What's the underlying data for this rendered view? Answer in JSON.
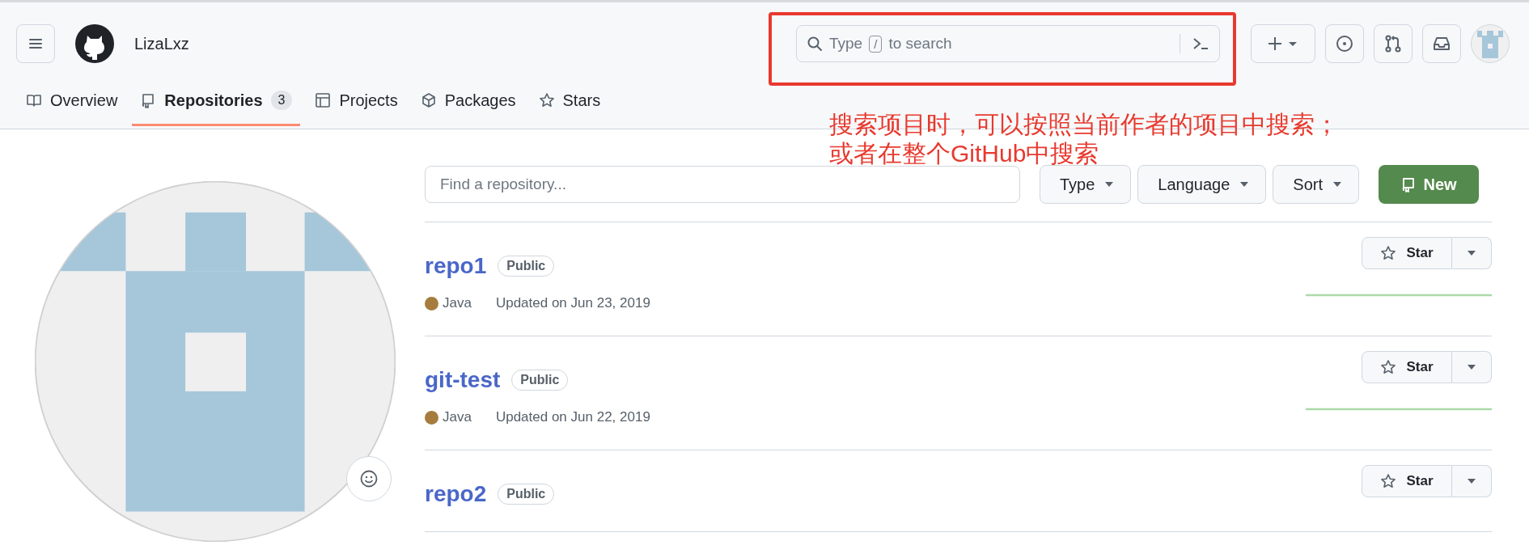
{
  "header": {
    "username": "LizaLxz",
    "search": {
      "hint_start": "Type",
      "hint_key": "/",
      "hint_end": "to search"
    }
  },
  "tabs": [
    {
      "label": "Overview",
      "selected": false
    },
    {
      "label": "Repositories",
      "selected": true,
      "count": "3"
    },
    {
      "label": "Projects",
      "selected": false
    },
    {
      "label": "Packages",
      "selected": false
    },
    {
      "label": "Stars",
      "selected": false
    }
  ],
  "annotation": {
    "lines": [
      "搜索项目时，可以按照当前作者的项目中搜索；",
      "或者在整个GitHub中搜索"
    ]
  },
  "filters": {
    "placeholder": "Find a repository...",
    "menus": [
      "Type",
      "Language",
      "Sort"
    ],
    "new_button": "New"
  },
  "repos": [
    {
      "name": "repo1",
      "visibility": "Public",
      "language": "Java",
      "color": "#a67c3e",
      "updated": "Updated on Jun 23, 2019",
      "star": "Star"
    },
    {
      "name": "git-test",
      "visibility": "Public",
      "language": "Java",
      "color": "#a67c3e",
      "updated": "Updated on Jun 22, 2019",
      "star": "Star"
    },
    {
      "name": "repo2",
      "visibility": "Public",
      "star": "Star"
    }
  ]
}
